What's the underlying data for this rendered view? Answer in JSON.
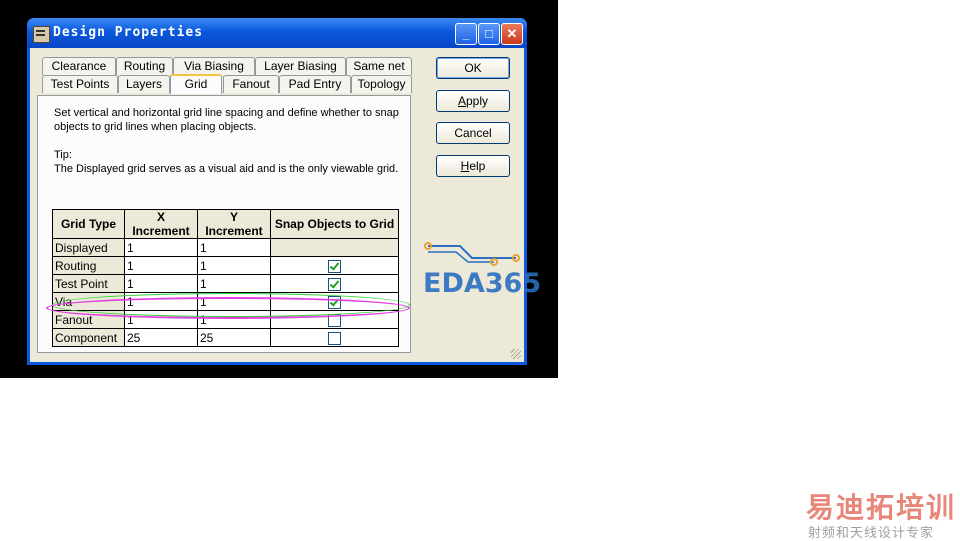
{
  "window": {
    "title": "Design Properties",
    "controls": [
      "minimize",
      "maximize",
      "close"
    ]
  },
  "tabs": {
    "row1": [
      "Clearance",
      "Routing",
      "Via Biasing",
      "Layer Biasing",
      "Same net"
    ],
    "row2": [
      "Test Points",
      "Layers",
      "Grid",
      "Fanout",
      "Pad Entry",
      "Topology"
    ],
    "active": "Grid"
  },
  "description": {
    "line1": "Set vertical and horizontal grid line spacing and define whether to snap objects to grid lines when placing objects.",
    "tip_label": "Tip:",
    "tip_text": "The Displayed grid serves as a visual aid and is the only viewable grid."
  },
  "table": {
    "headers": [
      "Grid Type",
      "X Increment",
      "Y Increment",
      "Snap Objects to Grid"
    ],
    "rows": [
      {
        "type": "Displayed",
        "x": "1",
        "y": "1",
        "snap": null
      },
      {
        "type": "Routing",
        "x": "1",
        "y": "1",
        "snap": true
      },
      {
        "type": "Test Point",
        "x": "1",
        "y": "1",
        "snap": true
      },
      {
        "type": "Via",
        "x": "1",
        "y": "1",
        "snap": true
      },
      {
        "type": "Fanout",
        "x": "1",
        "y": "1",
        "snap": false
      },
      {
        "type": "Component",
        "x": "25",
        "y": "25",
        "snap": false
      }
    ],
    "highlighted_row": "Fanout"
  },
  "buttons": {
    "ok": "OK",
    "apply": "Apply",
    "cancel": "Cancel",
    "help": "Help"
  },
  "watermarks": {
    "eda": "EDA365",
    "brand_cn": "易迪拓培训",
    "brand_sub": "射频和天线设计专家"
  },
  "colors": {
    "titlebar": "#0b58dc",
    "highlight_ellipse": "#e040e0",
    "checkmark": "#21a121"
  }
}
